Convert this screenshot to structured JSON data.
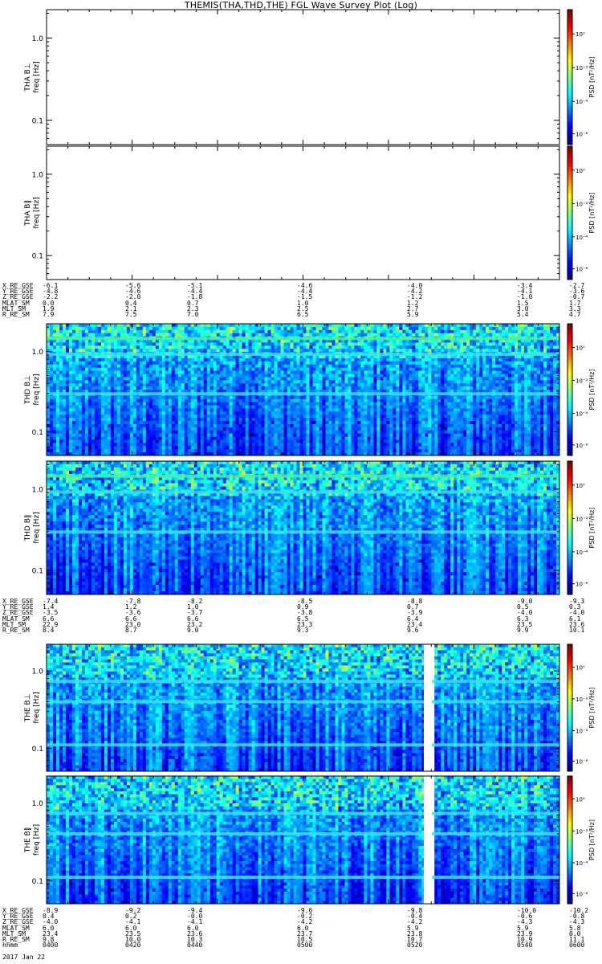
{
  "title": "THEMIS(THA,THD,THE) FGL Wave Survey Plot (Log)",
  "colors": {
    "frame": "#000000",
    "nodata": "#ffffff"
  },
  "chart_data": [
    {
      "type": "heatmap",
      "probe": "THA",
      "panels": [
        {
          "ylabel_top": "THA B⊥",
          "ylabel_bottom": "freq [Hz]",
          "yticks": [
            "1.0",
            "0.1"
          ],
          "yscale": "log",
          "data": "none",
          "cbar_label": "PSD [nT²/Hz]",
          "cbar_ticks": [
            "10⁰",
            "10⁻²",
            "10⁻⁴",
            "10⁻⁶"
          ]
        },
        {
          "ylabel_top": "THA B∥",
          "ylabel_bottom": "freq [Hz]",
          "yticks": [
            "1.0",
            "0.1"
          ],
          "yscale": "log",
          "data": "none",
          "cbar_label": "PSD [nT²/Hz]",
          "cbar_ticks": [
            "10⁰",
            "10⁻²",
            "10⁻⁴",
            "10⁻⁶"
          ]
        }
      ],
      "ephemeris": {
        "labels": [
          "X_RE_GSE",
          "Y_RE_GSE",
          "Z_RE_GSE",
          "MLAT_SM",
          "MLT_SM",
          "R_RE_SM"
        ],
        "columns": [
          [
            "-6.1",
            "-4.8",
            "-2.2",
            "0.0",
            "1.9",
            "7.9"
          ],
          [
            "-5.6",
            "-4.6",
            "-2.0",
            "0.4",
            "2.1",
            "7.5"
          ],
          [
            "-5.1",
            "-4.4",
            "-1.8",
            "0.7",
            "2.3",
            "7.0"
          ],
          [
            "-4.6",
            "-4.4",
            "-1.5",
            "1.0",
            "2.5",
            "6.5"
          ],
          [
            "-4.0",
            "-4.2",
            "-1.2",
            "1.2",
            "2.7",
            "5.9"
          ],
          [
            "-3.4",
            "-4.1",
            "-1.0",
            "1.5",
            "3.0",
            "5.4"
          ],
          [
            "-2.7",
            "-3.6",
            "-0.7",
            "1.7",
            "3.3",
            "4.7"
          ]
        ]
      }
    },
    {
      "type": "heatmap",
      "probe": "THD",
      "panels": [
        {
          "ylabel_top": "THD B⊥",
          "ylabel_bottom": "freq [Hz]",
          "yticks": [
            "1.0",
            "0.1"
          ],
          "yscale": "log",
          "data": "spectrogram",
          "cbar_label": "PSD [nT²/Hz]",
          "cbar_ticks": [
            "10⁰",
            "10⁻²",
            "10⁻⁴",
            "10⁻⁶"
          ]
        },
        {
          "ylabel_top": "THD B∥",
          "ylabel_bottom": "freq [Hz]",
          "yticks": [
            "1.0",
            "0.1"
          ],
          "yscale": "log",
          "data": "spectrogram",
          "cbar_label": "PSD [nT²/Hz]",
          "cbar_ticks": [
            "10⁰",
            "10⁻²",
            "10⁻⁴",
            "10⁻⁶"
          ]
        }
      ],
      "ephemeris": {
        "labels": [
          "X_RE_GSE",
          "Y_RE_GSE",
          "Z_RE_GSE",
          "MLAT_SM",
          "MLT_SM",
          "R_RE_SM"
        ],
        "columns": [
          [
            "-7.4",
            "1.4",
            "-3.5",
            "6.6",
            "22.9",
            "8.4"
          ],
          [
            "-7.8",
            "1.2",
            "-3.6",
            "6.6",
            "23.0",
            "8.7"
          ],
          [
            "-8.2",
            "1.0",
            "-3.7",
            "6.6",
            "23.2",
            "9.0"
          ],
          [
            "-8.5",
            "0.9",
            "-3.8",
            "6.5",
            "23.3",
            "9.3"
          ],
          [
            "-8.8",
            "0.7",
            "-3.9",
            "6.4",
            "23.4",
            "9.6"
          ],
          [
            "-9.0",
            "0.5",
            "-4.0",
            "6.3",
            "23.5",
            "9.9"
          ],
          [
            "-9.3",
            "0.3",
            "-4.0",
            "6.1",
            "23.6",
            "10.1"
          ]
        ]
      }
    },
    {
      "type": "heatmap",
      "probe": "THE",
      "panels": [
        {
          "ylabel_top": "THE B⊥",
          "ylabel_bottom": "freq [Hz]",
          "yticks": [
            "1.0",
            "0.1"
          ],
          "yscale": "log",
          "data": "spectrogram",
          "data_gap": "0525-0528",
          "cbar_label": "PSD [nT²/Hz]",
          "cbar_ticks": [
            "10⁰",
            "10⁻²",
            "10⁻⁴",
            "10⁻⁶"
          ]
        },
        {
          "ylabel_top": "THE B∥",
          "ylabel_bottom": "freq [Hz]",
          "yticks": [
            "1.0",
            "0.1"
          ],
          "yscale": "log",
          "data": "spectrogram",
          "data_gap": "0525-0528",
          "cbar_label": "PSD [nT²/Hz]",
          "cbar_ticks": [
            "10⁰",
            "10⁻²",
            "10⁻⁴",
            "10⁻⁶"
          ]
        }
      ],
      "ephemeris": {
        "labels": [
          "X_RE_GSE",
          "Y_RE_GSE",
          "Z_RE_GSE",
          "MLAT_SM",
          "MLT_SM",
          "R_RE_SM",
          "hhmm"
        ],
        "columns": [
          [
            "-8.9",
            "0.4",
            "-4.0",
            "6.0",
            "23.4",
            "9.8",
            "0400"
          ],
          [
            "-9.2",
            "0.2",
            "-4.1",
            "6.0",
            "23.5",
            "10.0",
            "0420"
          ],
          [
            "-9.4",
            "-0.0",
            "-4.1",
            "6.0",
            "23.6",
            "10.3",
            "0440"
          ],
          [
            "-9.6",
            "-0.2",
            "-4.2",
            "6.0",
            "23.7",
            "10.5",
            "0500"
          ],
          [
            "-9.8",
            "-0.4",
            "-4.2",
            "5.9",
            "23.8",
            "10.7",
            "0520"
          ],
          [
            "-10.0",
            "-0.6",
            "-4.3",
            "5.9",
            "23.9",
            "10.9",
            "0540"
          ],
          [
            "-10.2",
            "-0.8",
            "-4.3",
            "5.8",
            "0.0",
            "11.1",
            "0600"
          ]
        ]
      },
      "date": "2017 Jan 22"
    }
  ]
}
